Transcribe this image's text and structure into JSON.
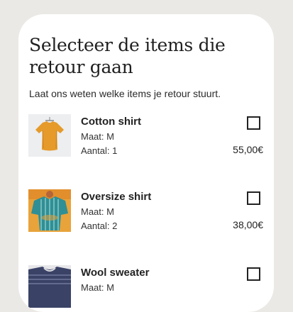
{
  "header": {
    "title": "Selecteer de items die retour gaan",
    "subtitle": "Laat ons weten welke items je retour stuurt."
  },
  "items": [
    {
      "name": "Cotton shirt",
      "size": "Maat: M",
      "quantity": "Aantal: 1",
      "price": "55,00€",
      "checked": false,
      "image_icon": "orange-shirt-image"
    },
    {
      "name": "Oversize shirt",
      "size": "Maat: M",
      "quantity": "Aantal: 2",
      "price": "38,00€",
      "checked": false,
      "image_icon": "teal-striped-shirt-image"
    },
    {
      "name": "Wool sweater",
      "size": "Maat: M",
      "quantity": "",
      "price": "",
      "checked": false,
      "image_icon": "navy-sweater-image"
    }
  ],
  "colors": {
    "background": "#ebe9e6",
    "card": "#ffffff",
    "text": "#222222"
  }
}
